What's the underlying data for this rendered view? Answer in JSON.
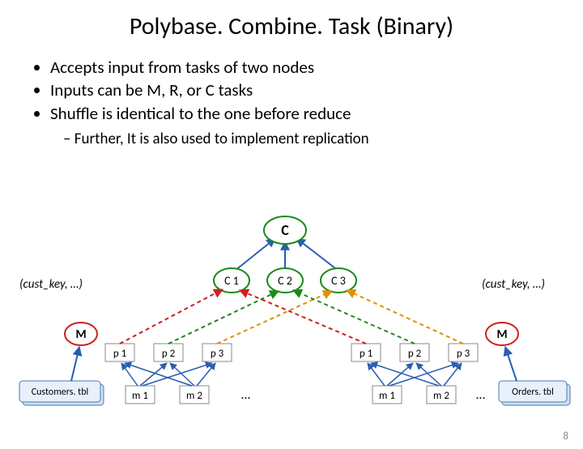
{
  "title": "Polybase. Combine. Task (Binary)",
  "bullets": [
    "Accepts input from tasks of two nodes",
    "Inputs can be M, R, or C tasks",
    "Shuffle is identical to the one before reduce"
  ],
  "sub_bullet": "Further, It is also used to implement replication",
  "top_node": "C",
  "combine_nodes": [
    "C 1",
    "C 2",
    "C 3"
  ],
  "key_label_left": "(cust_key, …)",
  "key_label_right": "(cust_key, …)",
  "m_label": "M",
  "partitions": [
    "p 1",
    "p 2",
    "p 3"
  ],
  "mappers": [
    "m 1",
    "m 2"
  ],
  "ellipsis": "…",
  "table_left": "Customers. tbl",
  "table_right": "Orders. tbl",
  "pagenum": "8"
}
